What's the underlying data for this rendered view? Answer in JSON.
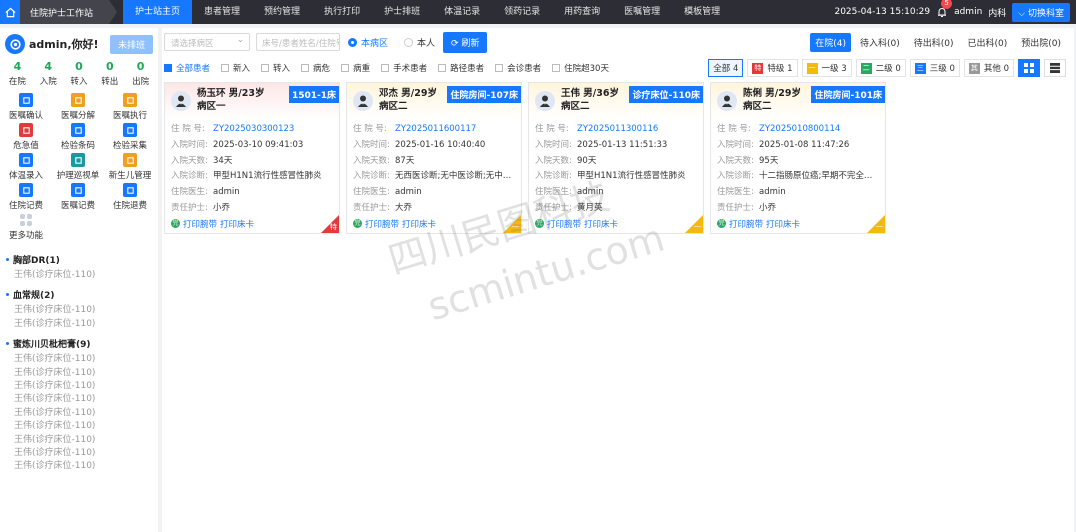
{
  "topbar": {
    "breadcrumb": "住院护士工作站",
    "nav": [
      "护士站主页",
      "患者管理",
      "预约管理",
      "执行打印",
      "护士排班",
      "体温记录",
      "领药记录",
      "用药查询",
      "医嘱管理",
      "模板管理"
    ],
    "active_nav": "护士站主页",
    "datetime": "2025-04-13 15:10:29",
    "badge": "5",
    "user": "admin",
    "dept": "内科",
    "switch_label": "切换科室"
  },
  "sidebar": {
    "greeting": "admin,你好!",
    "shift_label": "未排班",
    "stats": [
      {
        "n": "4",
        "l": "在院"
      },
      {
        "n": "4",
        "l": "入院"
      },
      {
        "n": "0",
        "l": "转入"
      },
      {
        "n": "0",
        "l": "转出"
      },
      {
        "n": "0",
        "l": "出院"
      }
    ],
    "funcs": [
      {
        "label": "医嘱确认",
        "icon": "order-confirm-icon",
        "color": "#1677ff"
      },
      {
        "label": "医嘱分解",
        "icon": "order-split-icon",
        "color": "#f0a020"
      },
      {
        "label": "医嘱执行",
        "icon": "printer-icon",
        "color": "#f0a020"
      },
      {
        "label": "危急值",
        "icon": "alarm-icon",
        "color": "#e33b3b"
      },
      {
        "label": "检验条码",
        "icon": "barcode-icon",
        "color": "#1677ff"
      },
      {
        "label": "检验采集",
        "icon": "test-tube-icon",
        "color": "#1677ff"
      },
      {
        "label": "体温录入",
        "icon": "thermometer-icon",
        "color": "#1677ff"
      },
      {
        "label": "护理巡视单",
        "icon": "patrol-icon",
        "color": "#1a9aa0"
      },
      {
        "label": "新生儿管理",
        "icon": "baby-icon",
        "color": "#f0a020"
      },
      {
        "label": "住院记费",
        "icon": "billing-icon",
        "color": "#1677ff"
      },
      {
        "label": "医嘱记费",
        "icon": "order-billing-icon",
        "color": "#1677ff"
      },
      {
        "label": "住院退费",
        "icon": "refund-icon",
        "color": "#1677ff"
      },
      {
        "label": "更多功能",
        "icon": "more-icon",
        "color": "#c7cfdc"
      }
    ],
    "groups": [
      {
        "title": "胸部DR(1)",
        "items": [
          "王伟(诊疗床位-110)"
        ]
      },
      {
        "title": "血常规(2)",
        "items": [
          "王伟(诊疗床位-110)",
          "王伟(诊疗床位-110)"
        ]
      },
      {
        "title": "蜜炼川贝枇杷膏(9)",
        "items": [
          "王伟(诊疗床位-110)",
          "王伟(诊疗床位-110)",
          "王伟(诊疗床位-110)",
          "王伟(诊疗床位-110)",
          "王伟(诊疗床位-110)",
          "王伟(诊疗床位-110)",
          "王伟(诊疗床位-110)",
          "王伟(诊疗床位-110)",
          "王伟(诊疗床位-110)"
        ]
      }
    ]
  },
  "filters": {
    "ward_placeholder": "请选择病区",
    "search_placeholder": "床号/患者姓名/住院号",
    "radio_ward": "本病区",
    "radio_self": "本人",
    "refresh": "刷新",
    "tabs": [
      "在院(4)",
      "待入科(0)",
      "待出科(0)",
      "已出科(0)",
      "预出院(0)"
    ],
    "checks": [
      "全部患者",
      "新入",
      "转入",
      "病危",
      "病重",
      "手术患者",
      "路径患者",
      "会诊患者",
      "住院超30天"
    ],
    "levels": [
      {
        "label": "全部",
        "count": "4",
        "color": ""
      },
      {
        "label": "特级",
        "count": "1",
        "color": "#e33b3b",
        "mark": "特"
      },
      {
        "label": "一级",
        "count": "3",
        "color": "#f2b90f",
        "mark": "一"
      },
      {
        "label": "二级",
        "count": "0",
        "color": "#2aa760",
        "mark": "二"
      },
      {
        "label": "三级",
        "count": "0",
        "color": "#1677ff",
        "mark": "三"
      },
      {
        "label": "其他",
        "count": "0",
        "color": "#999999",
        "mark": "其"
      }
    ]
  },
  "field_labels": {
    "no": "住 院 号:",
    "in_time": "入院时间:",
    "days": "入院天数:",
    "diag": "入院诊断:",
    "doctor": "住院医生:",
    "nurse": "责任护士:"
  },
  "card_actions": {
    "print_band": "打印腕带",
    "print_card": "打印床卡",
    "green": "完"
  },
  "patients": [
    {
      "name": "杨玉环 男/23岁",
      "ward": "病区一",
      "bed": "1501-1床",
      "no": "ZY2025030300123",
      "in_time": "2025-03-10 09:41:03",
      "days": "34天",
      "diag": "甲型H1N1流行性感冒性肺炎",
      "doctor": "admin",
      "nurse": "小乔",
      "level": "red",
      "corner": "特"
    },
    {
      "name": "邓杰 男/29岁",
      "ward": "病区二",
      "bed": "住院房间-107床",
      "no": "ZY2025011600117",
      "in_time": "2025-01-16 10:40:40",
      "days": "87天",
      "diag": "无西医诊断;无中医诊断;无中…",
      "doctor": "admin",
      "nurse": "大乔",
      "level": "yel",
      "corner": "一"
    },
    {
      "name": "王伟 男/36岁",
      "ward": "病区二",
      "bed": "诊疗床位-110床",
      "no": "ZY2025011300116",
      "in_time": "2025-01-13 11:51:33",
      "days": "90天",
      "diag": "甲型H1N1流行性感冒性肺炎",
      "doctor": "admin",
      "nurse": "黄月英",
      "level": "yel",
      "corner": "一"
    },
    {
      "name": "陈俐 男/29岁",
      "ward": "病区二",
      "bed": "住院房间-101床",
      "no": "ZY2025010800114",
      "in_time": "2025-01-08 11:47:26",
      "days": "95天",
      "diag": "十二指肠原位癌;早期不完全…",
      "doctor": "admin",
      "nurse": "小乔",
      "level": "yel",
      "corner": "一"
    }
  ],
  "watermark": [
    "四川民图科技",
    "scmintu.com"
  ]
}
